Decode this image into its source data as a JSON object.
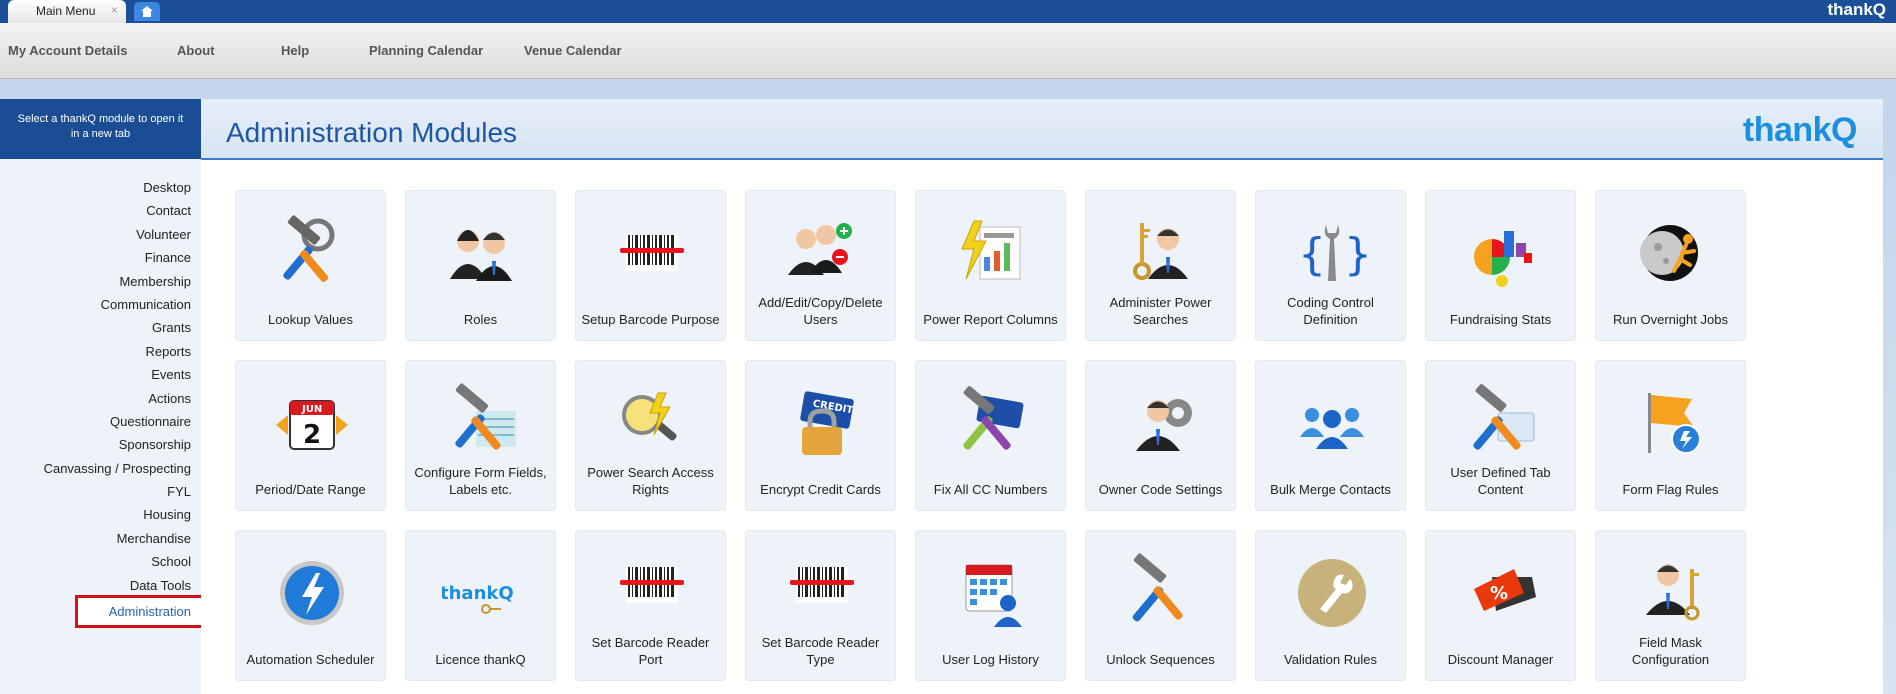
{
  "tabs": [
    {
      "label": "Main Menu",
      "close": "×"
    }
  ],
  "top_brand": "thankQ",
  "menubar": [
    "My Account Details",
    "About",
    "Help",
    "Planning Calendar",
    "Venue Calendar"
  ],
  "sidebar": {
    "header": "Select a thankQ module to open it in a new tab",
    "items": [
      "Desktop",
      "Contact",
      "Volunteer",
      "Finance",
      "Membership",
      "Communication",
      "Grants",
      "Reports",
      "Events",
      "Actions",
      "Questionnaire",
      "Sponsorship",
      "Canvassing / Prospecting",
      "FYL",
      "Housing",
      "Merchandise",
      "School",
      "Data Tools"
    ],
    "active": "Administration"
  },
  "main": {
    "title": "Administration Modules",
    "logo": "thankQ"
  },
  "tiles": [
    {
      "label": "Lookup Values",
      "icon": "tools-magnifier-icon"
    },
    {
      "label": "Roles",
      "icon": "people-pair-icon"
    },
    {
      "label": "Setup Barcode Purpose",
      "icon": "barcode-icon"
    },
    {
      "label": "Add/Edit/Copy/Delete Users",
      "icon": "users-add-remove-icon"
    },
    {
      "label": "Power Report Columns",
      "icon": "power-report-icon"
    },
    {
      "label": "Administer Power Searches",
      "icon": "key-user-icon"
    },
    {
      "label": "Coding Control Definition",
      "icon": "wrench-braces-icon"
    },
    {
      "label": "Fundraising Stats",
      "icon": "chart-pie-icon"
    },
    {
      "label": "Run Overnight Jobs",
      "icon": "moon-runner-icon"
    },
    {
      "label": "Period/Date Range",
      "icon": "calendar-icon"
    },
    {
      "label": "Configure Form Fields, Labels etc.",
      "icon": "tools-form-icon"
    },
    {
      "label": "Power Search Access Rights",
      "icon": "search-lightning-icon"
    },
    {
      "label": "Encrypt Credit Cards",
      "icon": "credit-lock-icon"
    },
    {
      "label": "Fix All CC Numbers",
      "icon": "credit-tools-icon"
    },
    {
      "label": "Owner Code Settings",
      "icon": "user-gear-icon"
    },
    {
      "label": "Bulk Merge Contacts",
      "icon": "group-merge-icon"
    },
    {
      "label": "User Defined Tab Content",
      "icon": "tools-tab-icon"
    },
    {
      "label": "Form Flag Rules",
      "icon": "flag-icon"
    },
    {
      "label": "Automation Scheduler",
      "icon": "automation-icon"
    },
    {
      "label": "Licence thankQ",
      "icon": "licence-icon",
      "logo_text": "thankQ"
    },
    {
      "label": "Set Barcode Reader Port",
      "icon": "barcode-icon"
    },
    {
      "label": "Set Barcode Reader Type",
      "icon": "barcode-icon"
    },
    {
      "label": "User Log History",
      "icon": "calendar-user-icon"
    },
    {
      "label": "Unlock Sequences",
      "icon": "tools-icon"
    },
    {
      "label": "Validation Rules",
      "icon": "wrench-circle-icon"
    },
    {
      "label": "Discount Manager",
      "icon": "discount-tag-icon"
    },
    {
      "label": "Field Mask Configuration",
      "icon": "key-user-icon"
    }
  ],
  "colors": {
    "brand_blue": "#1b4f9a",
    "title_blue": "#1e56a6",
    "highlight_red": "#d0101a"
  }
}
